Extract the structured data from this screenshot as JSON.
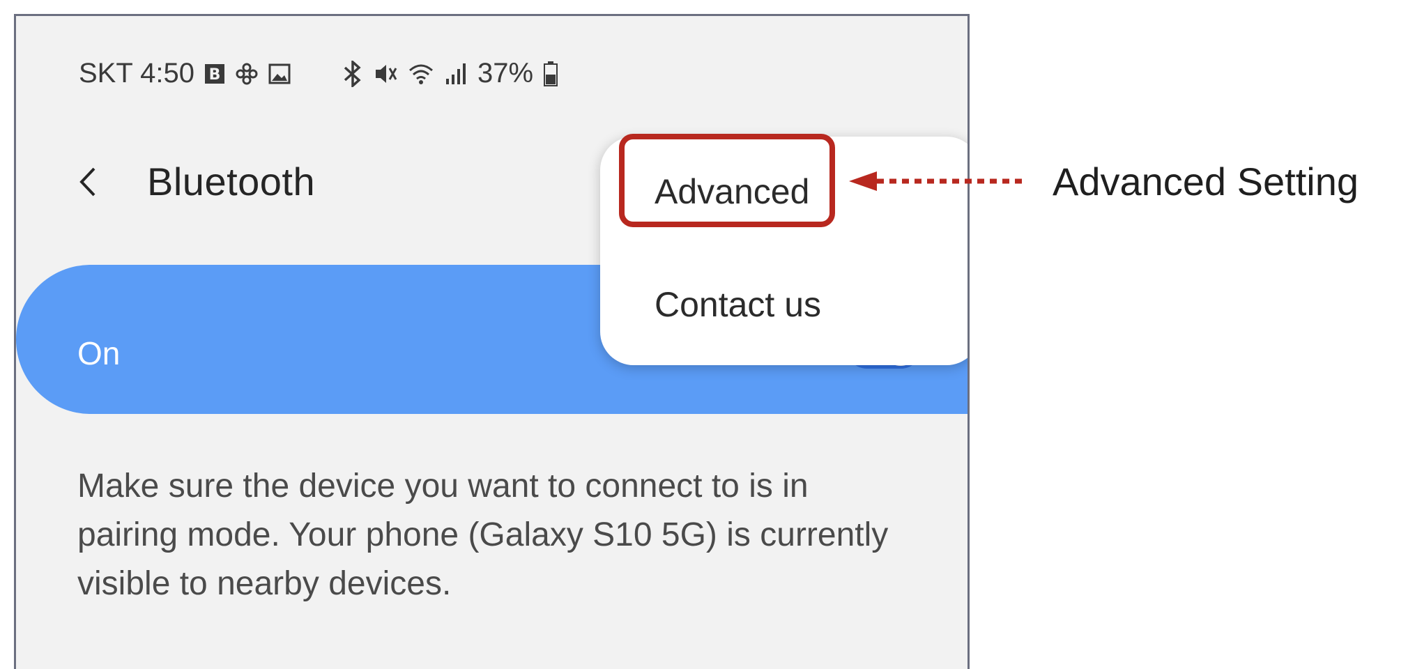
{
  "status_bar": {
    "carrier_time": "SKT 4:50",
    "battery": "37%",
    "icons": [
      "b-app-icon",
      "flower-icon",
      "gallery-icon",
      "bluetooth-icon",
      "mute-icon",
      "wifi-icon",
      "signal-icon",
      "battery-icon"
    ]
  },
  "header": {
    "back_icon": "chevron-left-icon",
    "title": "Bluetooth"
  },
  "toggle": {
    "label": "On",
    "state": "on",
    "color": "#5b9cf6"
  },
  "description": "Make sure the device you want to connect to is in pairing mode. Your phone (Galaxy S10 5G) is currently visible to nearby devices.",
  "menu": {
    "items": [
      {
        "label": "Advanced"
      },
      {
        "label": "Contact us"
      }
    ]
  },
  "annotation": {
    "label": "Advanced Setting",
    "highlight_color": "#b8281f"
  }
}
